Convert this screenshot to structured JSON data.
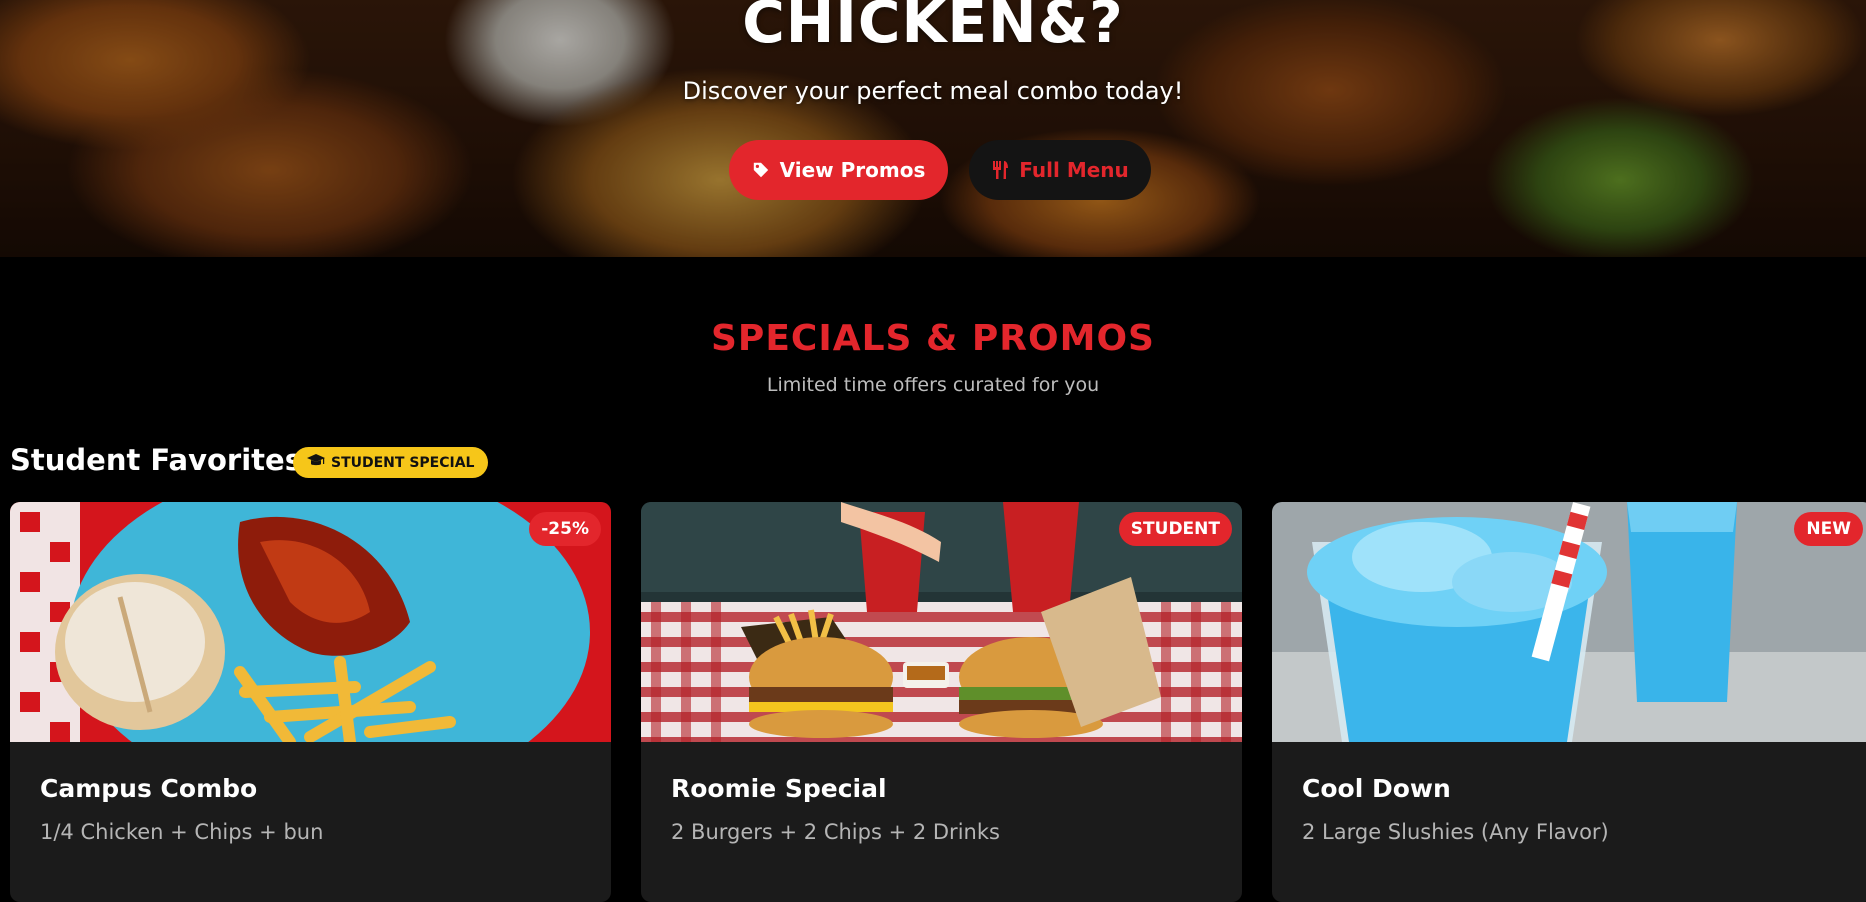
{
  "hero": {
    "title": "CHICKEN&?",
    "subtitle": "Discover your perfect meal combo today!",
    "promos_button": "View Promos",
    "menu_button": "Full Menu"
  },
  "specials": {
    "title": "SPECIALS & PROMOS",
    "subtitle": "Limited time offers curated for you"
  },
  "group": {
    "title": "Student Favorites",
    "badge": "STUDENT SPECIAL"
  },
  "cards": [
    {
      "tag": "-25%",
      "title": "Campus Combo",
      "description": "1/4 Chicken + Chips + bun"
    },
    {
      "tag": "STUDENT",
      "title": "Roomie Special",
      "description": "2 Burgers + 2 Chips + 2 Drinks"
    },
    {
      "tag": "NEW",
      "title": "Cool Down",
      "description": "2 Large Slushies (Any Flavor)"
    }
  ],
  "icons": {
    "promos": "tag-icon",
    "menu": "utensils-icon",
    "badge": "graduation-cap-icon"
  },
  "colors": {
    "accent": "#e3262c",
    "badge": "#f6c619",
    "background": "#000000",
    "card": "#1b1b1b"
  }
}
